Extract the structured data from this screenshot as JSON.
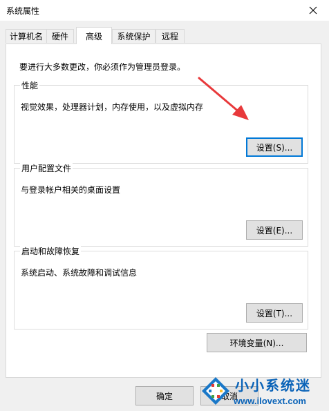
{
  "window": {
    "title": "系统属性"
  },
  "tabs": [
    {
      "label": "计算机名"
    },
    {
      "label": "硬件"
    },
    {
      "label": "高级"
    },
    {
      "label": "系统保护"
    },
    {
      "label": "远程"
    }
  ],
  "active_tab": "高级",
  "intro_text": "要进行大多数更改，你必须作为管理员登录。",
  "groups": {
    "performance": {
      "title": "性能",
      "description": "视觉效果，处理器计划，内存使用，以及虚拟内存",
      "button": "设置(S)..."
    },
    "user_profiles": {
      "title": "用户配置文件",
      "description": "与登录帐户相关的桌面设置",
      "button": "设置(E)..."
    },
    "startup_recovery": {
      "title": "启动和故障恢复",
      "description": "系统启动、系统故障和调试信息",
      "button": "设置(T)..."
    }
  },
  "env_button": "环境变量(N)...",
  "footer": {
    "ok": "确定",
    "cancel": "取消"
  },
  "watermark": {
    "name": "小小系统迷",
    "url": "www.ilovext.com"
  },
  "colors": {
    "accent": "#0078d7",
    "arrow": "#e8393b",
    "watermark": "#0a63b8"
  },
  "icons": {
    "close": "close-icon",
    "arrow": "red-arrow-annotation",
    "logo": "xiaoxiao-logo-icon"
  }
}
